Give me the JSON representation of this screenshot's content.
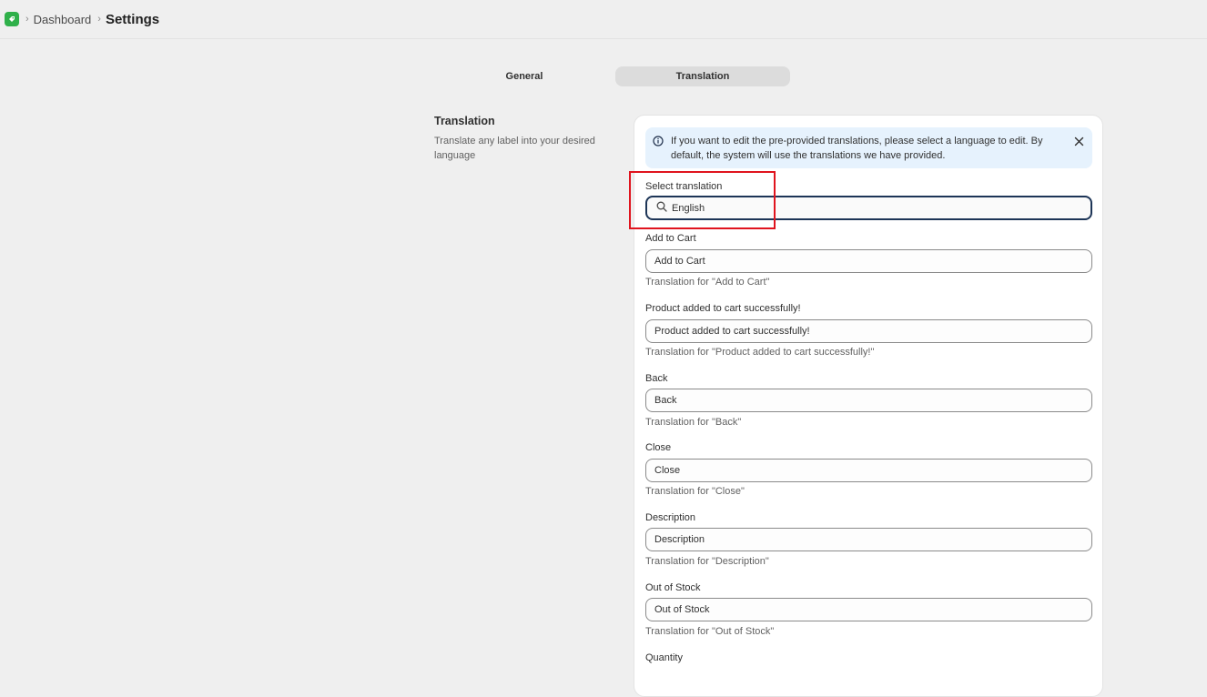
{
  "breadcrumb": {
    "parent": "Dashboard",
    "current": "Settings"
  },
  "tabs": [
    {
      "label": "General",
      "active": false
    },
    {
      "label": "Translation",
      "active": true
    }
  ],
  "section": {
    "title": "Translation",
    "description": "Translate any label into your desired language"
  },
  "banner": {
    "text": "If you want to edit the pre-provided translations, please select a language to edit. By default, the system will use the translations we have provided."
  },
  "select_translation": {
    "label": "Select translation",
    "value": "English"
  },
  "fields": [
    {
      "label": "Add to Cart",
      "value": "Add to Cart",
      "help": "Translation for \"Add to Cart\""
    },
    {
      "label": "Product added to cart successfully!",
      "value": "Product added to cart successfully!",
      "help": "Translation for \"Product added to cart successfully!\""
    },
    {
      "label": "Back",
      "value": "Back",
      "help": "Translation for \"Back\""
    },
    {
      "label": "Close",
      "value": "Close",
      "help": "Translation for \"Close\""
    },
    {
      "label": "Description",
      "value": "Description",
      "help": "Translation for \"Description\""
    },
    {
      "label": "Out of Stock",
      "value": "Out of Stock",
      "help": "Translation for \"Out of Stock\""
    },
    {
      "label": "Quantity"
    }
  ],
  "colors": {
    "highlight": "#e0141e",
    "banner_bg": "#e6f2fd",
    "focus_border": "#1d3557",
    "logo": "#2fb04a"
  }
}
